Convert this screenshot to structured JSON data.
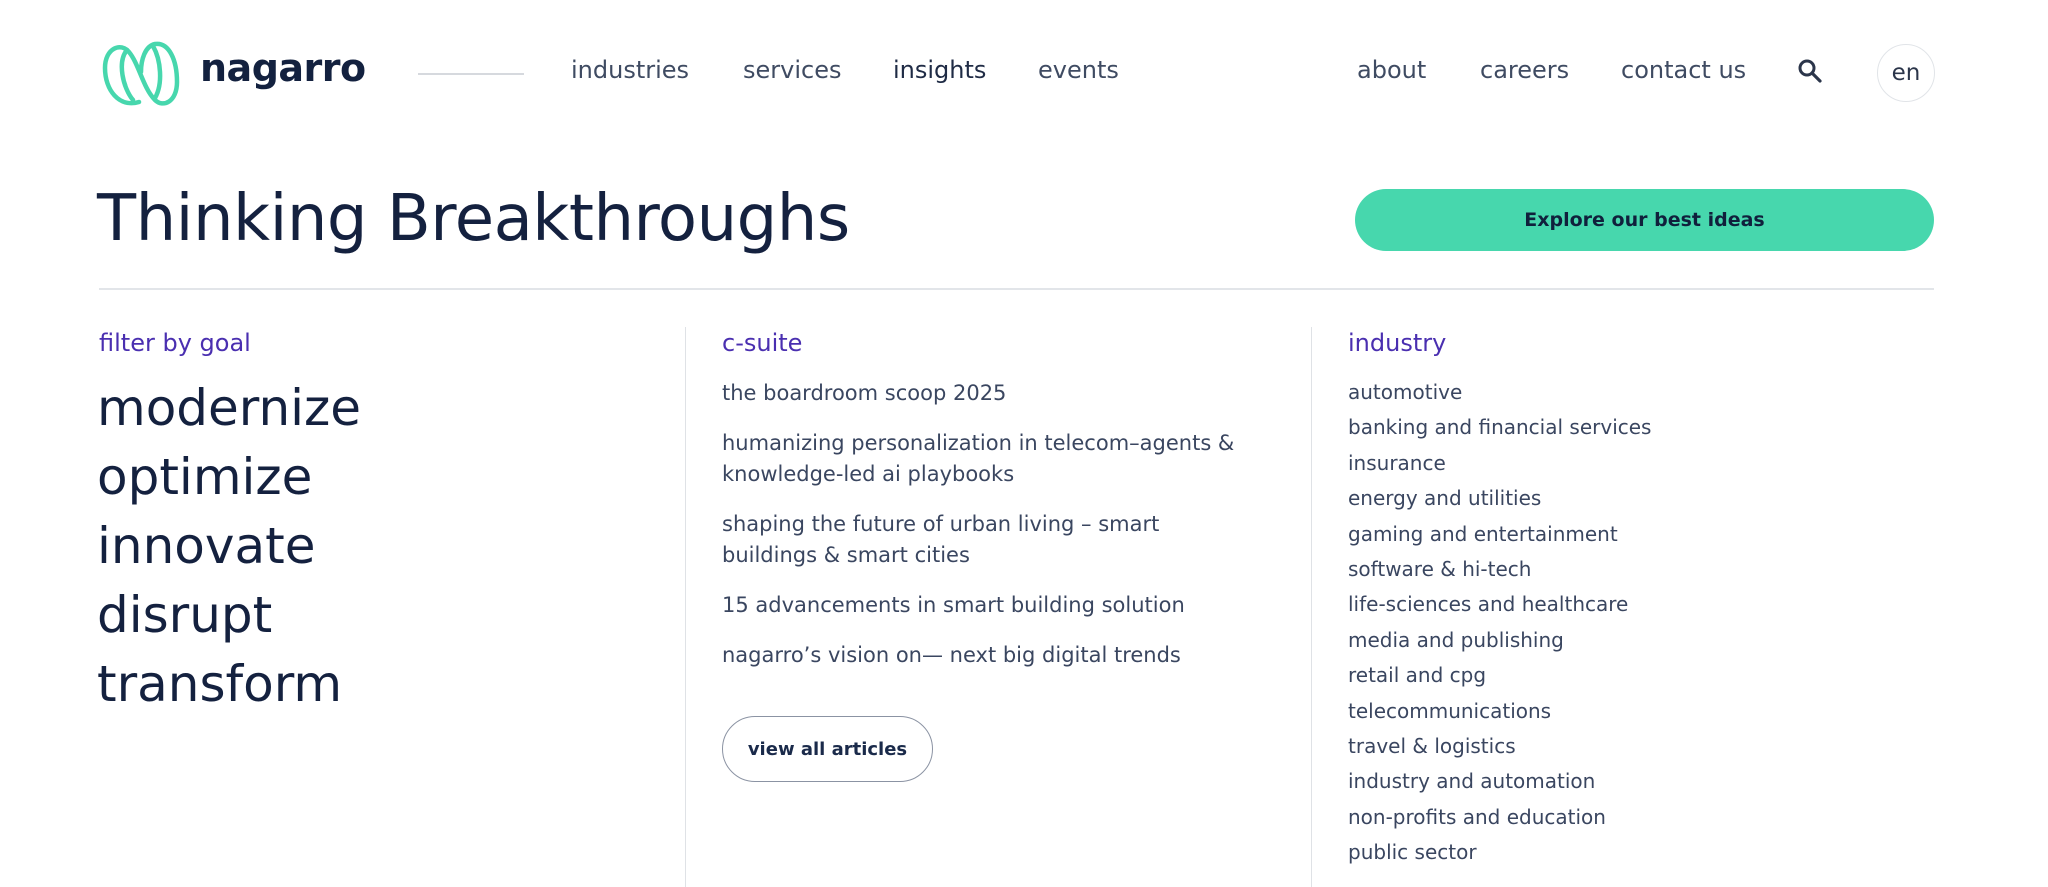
{
  "brand": {
    "name": "nagarro",
    "accent": "#47d7ad"
  },
  "nav": {
    "primary": [
      "industries",
      "services",
      "insights",
      "events"
    ],
    "secondary": [
      "about",
      "careers",
      "contact us"
    ],
    "search_icon": "search-icon",
    "language": "en"
  },
  "hero": {
    "title": "Thinking Breakthroughs",
    "cta_label": "Explore our best ideas"
  },
  "goals": {
    "heading": "filter by goal",
    "items": [
      "modernize",
      "optimize",
      "innovate",
      "disrupt",
      "transform"
    ]
  },
  "csuite": {
    "heading": "c-suite",
    "articles": [
      "the boardroom scoop 2025",
      "humanizing personalization in telecom–agents & knowledge-led ai playbooks",
      "shaping the future of urban living – smart buildings & smart cities",
      "15 advancements in smart building solution",
      "nagarro’s vision on— next big digital trends"
    ],
    "view_all_label": "view all articles"
  },
  "industry": {
    "heading": "industry",
    "items": [
      "automotive",
      "banking and financial services",
      "insurance",
      "energy and utilities",
      "gaming and entertainment",
      "software & hi-tech",
      "life-sciences and healthcare",
      "media and publishing",
      "retail and cpg",
      "telecommunications",
      "travel & logistics",
      "industry and automation",
      "non-profits and education",
      "public sector"
    ]
  },
  "colors": {
    "heading_purple": "#4a2fb0",
    "text_navy": "#14213f",
    "cta_green": "#47d7ad"
  }
}
